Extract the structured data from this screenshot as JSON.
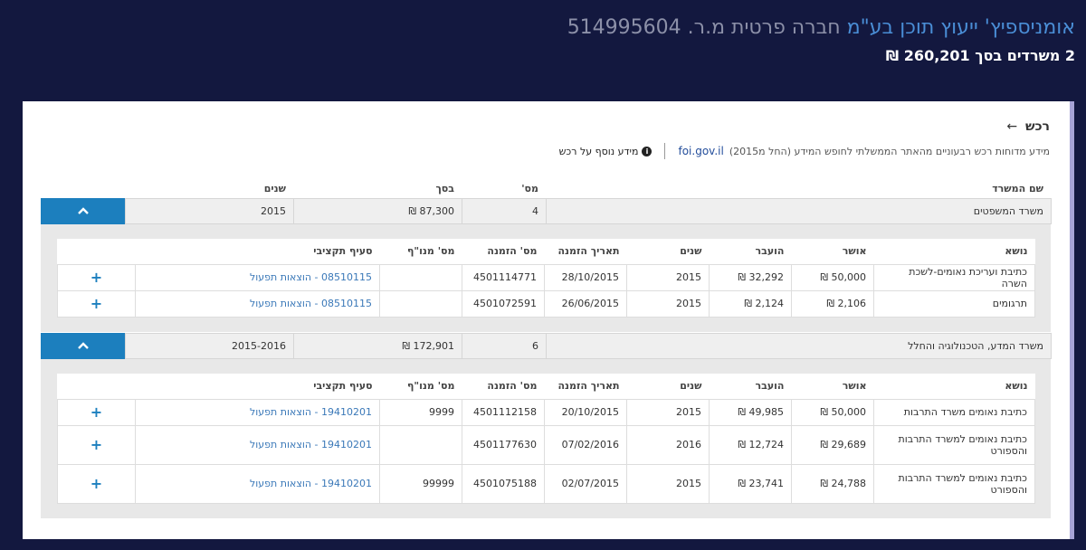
{
  "header": {
    "company_name": "אומניספיץ' ייעוץ תוכן בע\"מ",
    "company_type": " חברה פרטית מ.ר. 514995604",
    "summary": "2 משרדים בסך 260,201 ₪"
  },
  "card": {
    "title": "רכש",
    "back_arrow": "←",
    "description": "מידע מדוחות רכש רבעוניים מהאתר הממשלתי לחופש המידע (החל מ2015)",
    "site": "foi.gov.il",
    "more_info": "מידע נוסף על רכש",
    "info_icon": "info-icon"
  },
  "outer_columns": {
    "ministry": "שם המשרד",
    "count": "מס'",
    "total": "בסך",
    "years": "שנים"
  },
  "inner_columns": {
    "subject": "נושא",
    "approved": "אושר",
    "transferred": "הועבר",
    "years": "שנים",
    "order_date": "תאריך הזמנה",
    "order_num": "מס' הזמנה",
    "subscription": "מס' מנו\"ף",
    "budget_item": "סעיף תקציבי"
  },
  "ministries": [
    {
      "name": "משרד המשפטים",
      "count": "4",
      "total": "87,300 ₪",
      "years": "2015",
      "toggle_icon": "chevron-up-icon",
      "rows": [
        {
          "subject": "כתיבת ועריכת נאומים-לשכת השרה",
          "approved": "50,000 ₪",
          "transferred": "32,292 ₪",
          "years": "2015",
          "order_date": "28/10/2015",
          "order_num": "4501114771",
          "subscription": "",
          "budget_item": "08510115 - הוצאות תפעול"
        },
        {
          "subject": "תרגומים",
          "approved": "2,106 ₪",
          "transferred": "2,124 ₪",
          "years": "2015",
          "order_date": "26/06/2015",
          "order_num": "4501072591",
          "subscription": "",
          "budget_item": "08510115 - הוצאות תפעול"
        }
      ]
    },
    {
      "name": "משרד המדע, הטכנולוגיה והחלל",
      "count": "6",
      "total": "172,901 ₪",
      "years": "2015-2016",
      "toggle_icon": "chevron-up-icon",
      "rows": [
        {
          "subject": "כתיבת נאומים משרד התרבות",
          "approved": "50,000 ₪",
          "transferred": "49,985 ₪",
          "years": "2015",
          "order_date": "20/10/2015",
          "order_num": "4501112158",
          "subscription": "9999",
          "budget_item": "19410201 - הוצאות תפעול"
        },
        {
          "subject": "כתיבת נאומים למשרד התרבות והספורט",
          "approved": "29,689 ₪",
          "transferred": "12,724 ₪",
          "years": "2016",
          "order_date": "07/02/2016",
          "order_num": "4501177630",
          "subscription": "",
          "budget_item": "19410201 - הוצאות תפעול"
        },
        {
          "subject": "כתיבת נאומים למשרד התרבות והספורט",
          "approved": "24,788 ₪",
          "transferred": "23,741 ₪",
          "years": "2015",
          "order_date": "02/07/2015",
          "order_num": "4501075188",
          "subscription": "99999",
          "budget_item": "19410201 - הוצאות תפעול"
        }
      ]
    }
  ],
  "colors": {
    "background": "#13183f",
    "accent": "#1c7fbe",
    "link": "#4a8ed6"
  }
}
